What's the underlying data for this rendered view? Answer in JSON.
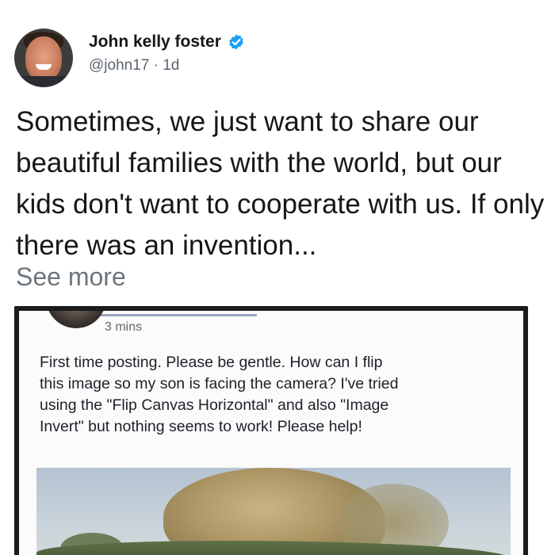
{
  "author": {
    "display_name": "John kelly foster",
    "handle": "@john17",
    "age": "1d",
    "verified_color": "#1da1f2"
  },
  "tweet": {
    "text": "Sometimes, we just want to share our beautiful families with the world, but our kids don't want to cooperate with us. If only there was an invention...",
    "see_more": "See more"
  },
  "embedded_post": {
    "time": "3 mins",
    "text": "First time posting. Please be gentle.  How can I flip\nthis image so my son is facing the camera?  I've tried\nusing the \"Flip Canvas Horizontal\" and also \"Image\nInvert\" but nothing seems to work!  Please help!"
  },
  "icons": {
    "verified": "verified-badge-icon"
  }
}
